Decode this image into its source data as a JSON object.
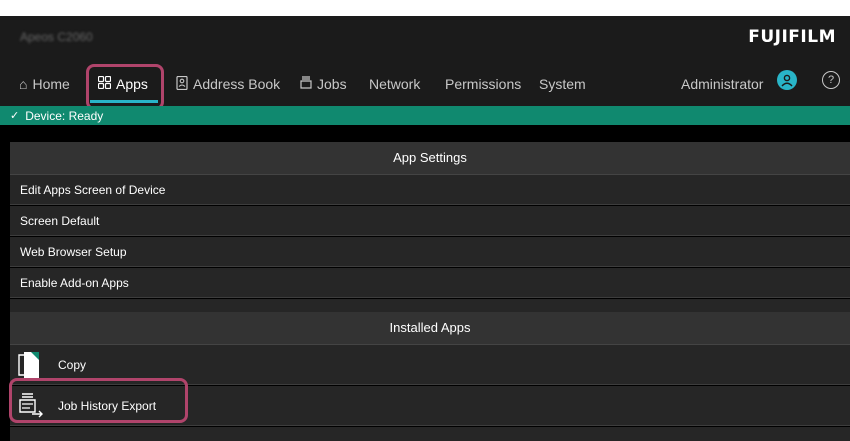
{
  "header": {
    "device_name": "Apeos C2060",
    "brand": "FUJIFILM"
  },
  "nav": {
    "home": "Home",
    "apps": "Apps",
    "address_book": "Address Book",
    "jobs": "Jobs",
    "network": "Network",
    "permissions": "Permissions",
    "system": "System",
    "user": "Administrator",
    "help": "?"
  },
  "status": {
    "text": "Device: Ready"
  },
  "app_settings": {
    "header": "App Settings",
    "items": [
      "Edit Apps Screen of Device",
      "Screen Default",
      "Web Browser Setup",
      "Enable Add-on Apps"
    ]
  },
  "installed_apps": {
    "header": "Installed Apps",
    "items": [
      {
        "label": "Copy",
        "icon": "copy-icon"
      },
      {
        "label": "Job History Export",
        "icon": "job-history-export-icon"
      }
    ]
  },
  "colors": {
    "accent": "#29b5c8",
    "status_green": "#10896f",
    "highlight": "#b0446b"
  }
}
